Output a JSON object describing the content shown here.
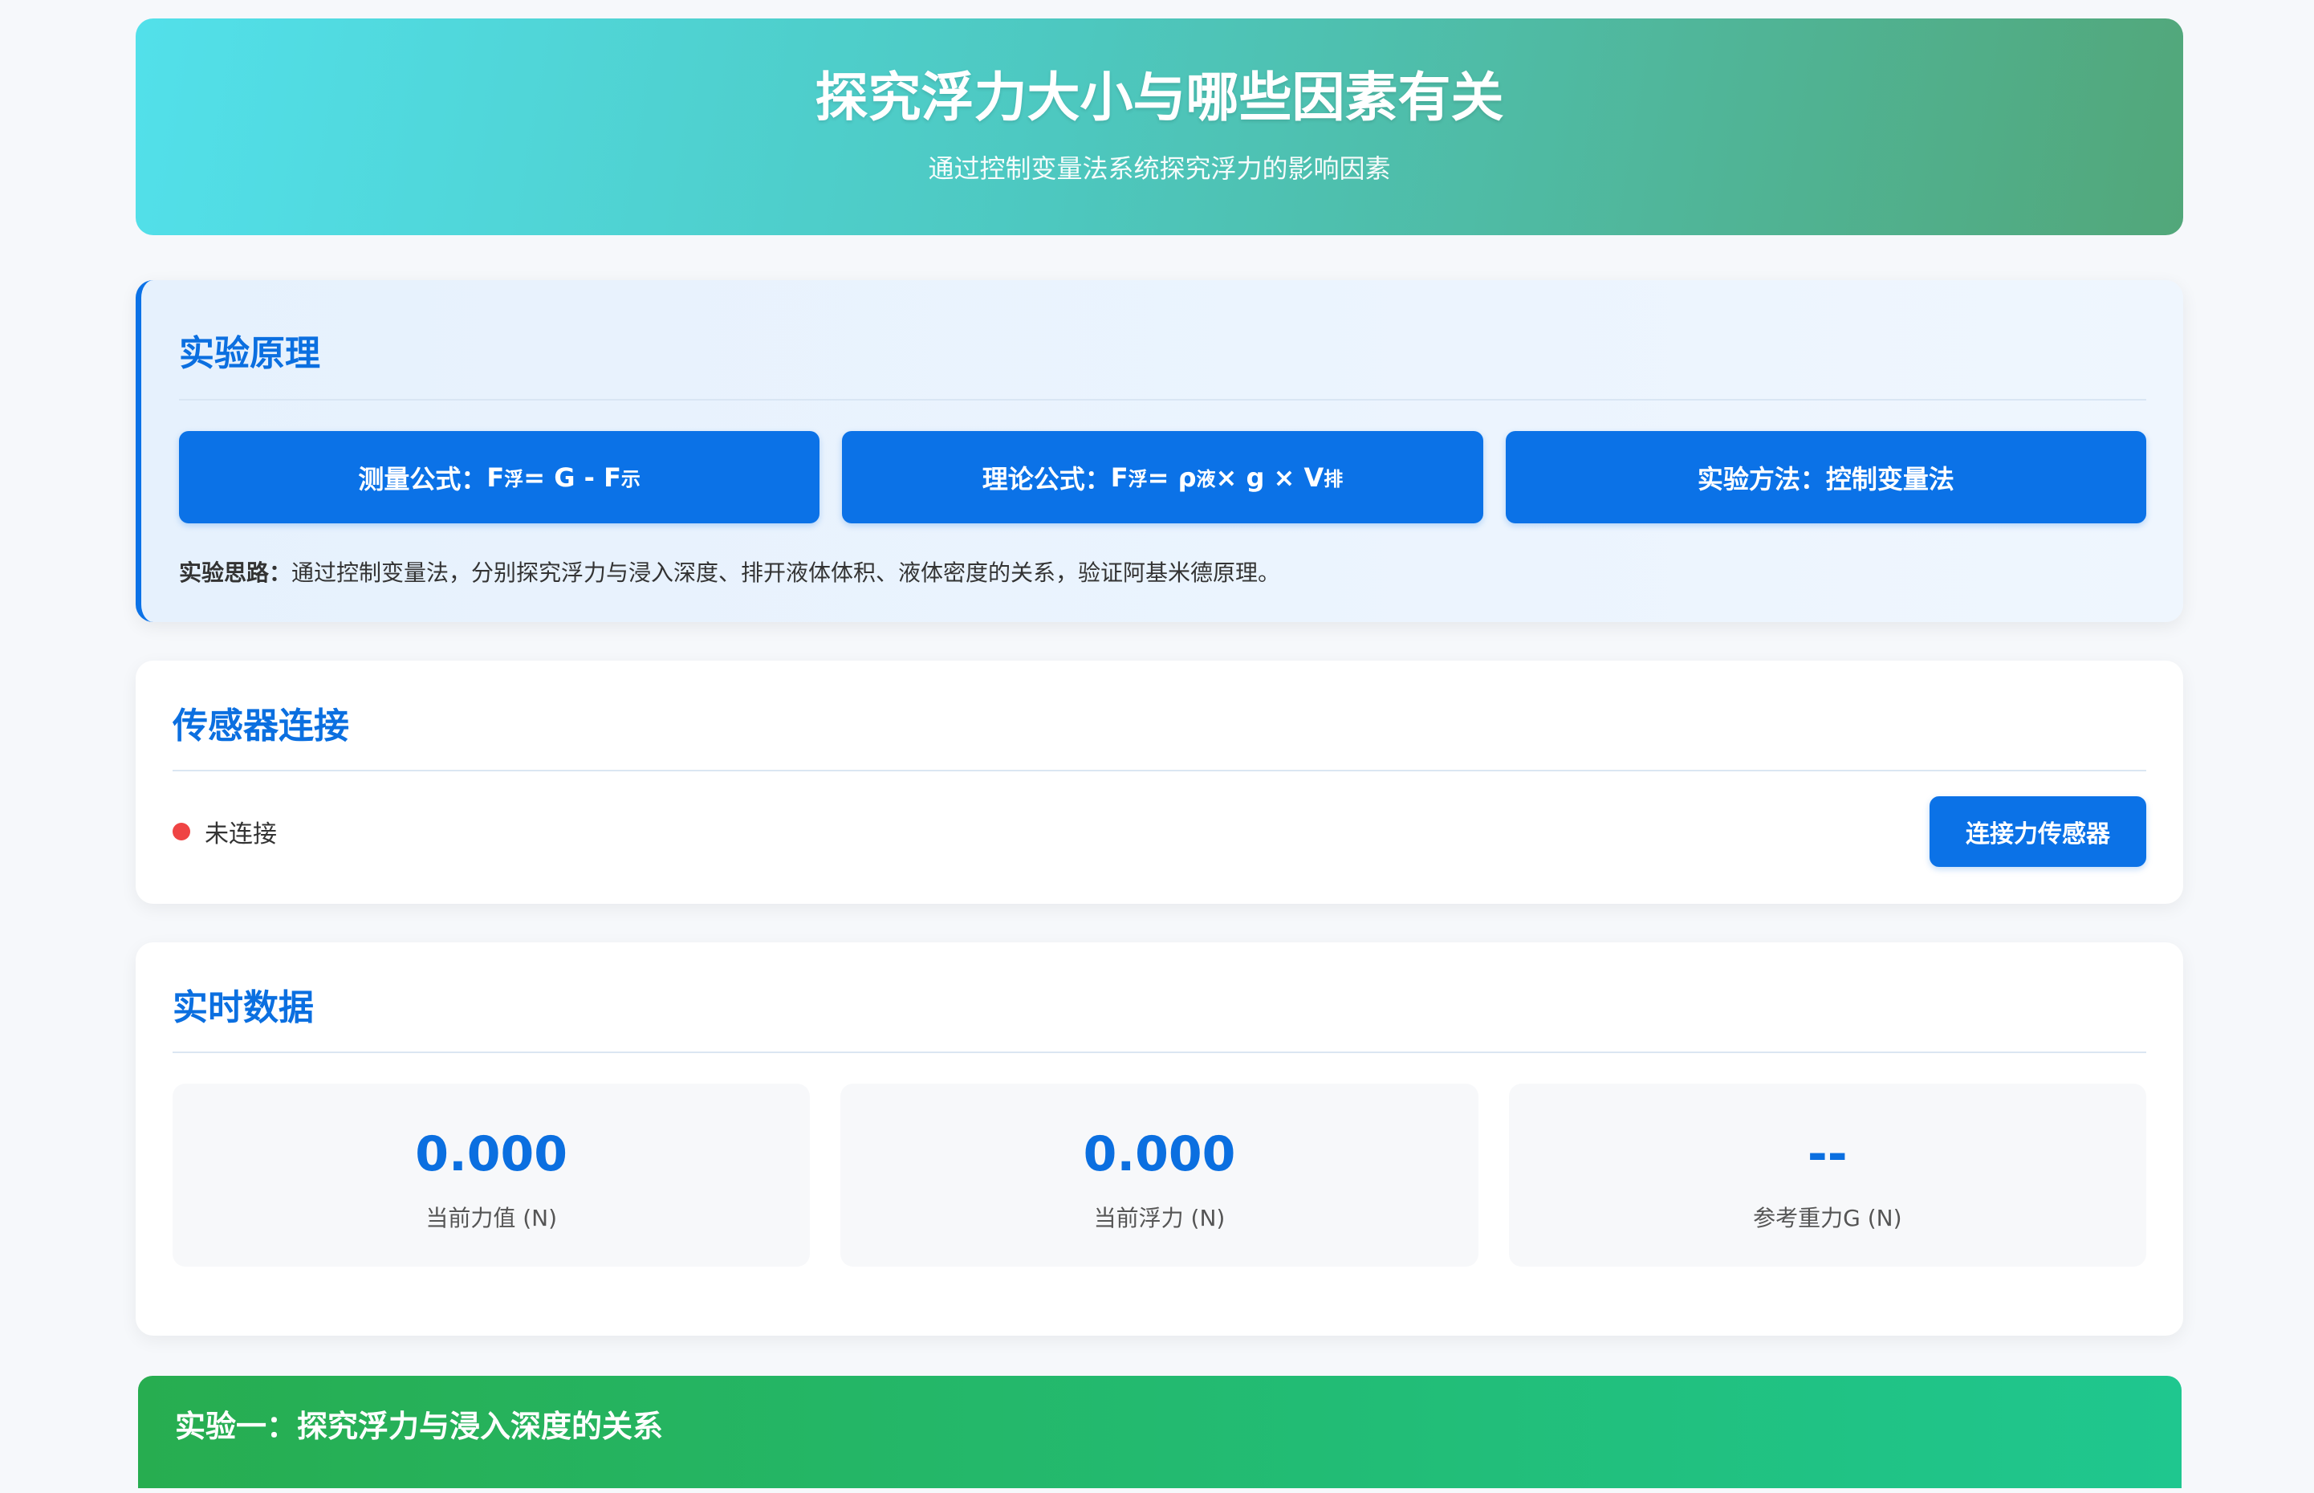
{
  "header": {
    "title": "探究浮力大小与哪些因素有关",
    "subtitle": "通过控制变量法系统探究浮力的影响因素"
  },
  "principle": {
    "title": "实验原理",
    "formulas": [
      {
        "label": "测量公式：",
        "parts": [
          [
            "F",
            "浮"
          ],
          [
            " = G - F",
            "示"
          ]
        ]
      },
      {
        "label": "理论公式：",
        "parts": [
          [
            "F",
            "浮"
          ],
          [
            " = ρ",
            "液"
          ],
          [
            " × g × V",
            "排"
          ]
        ]
      },
      {
        "label": "实验方法：控制变量法",
        "parts": []
      }
    ],
    "idea_label": "实验思路：",
    "idea_text": "通过控制变量法，分别探究浮力与浸入深度、排开液体体积、液体密度的关系，验证阿基米德原理。"
  },
  "sensor": {
    "title": "传感器连接",
    "status_text": "未连接",
    "status_color": "#ef4444",
    "connect_label": "连接力传感器"
  },
  "realtime": {
    "title": "实时数据",
    "metrics": [
      {
        "value": "0.000",
        "label": "当前力值 (N)"
      },
      {
        "value": "0.000",
        "label": "当前浮力 (N)"
      },
      {
        "value": "--",
        "label": "参考重力G (N)"
      }
    ]
  },
  "experiment1": {
    "title": "实验一：探究浮力与浸入深度的关系"
  },
  "colors": {
    "accent": "#0b72e7",
    "green_start": "#27ad50",
    "green_end": "#1fc78f"
  }
}
